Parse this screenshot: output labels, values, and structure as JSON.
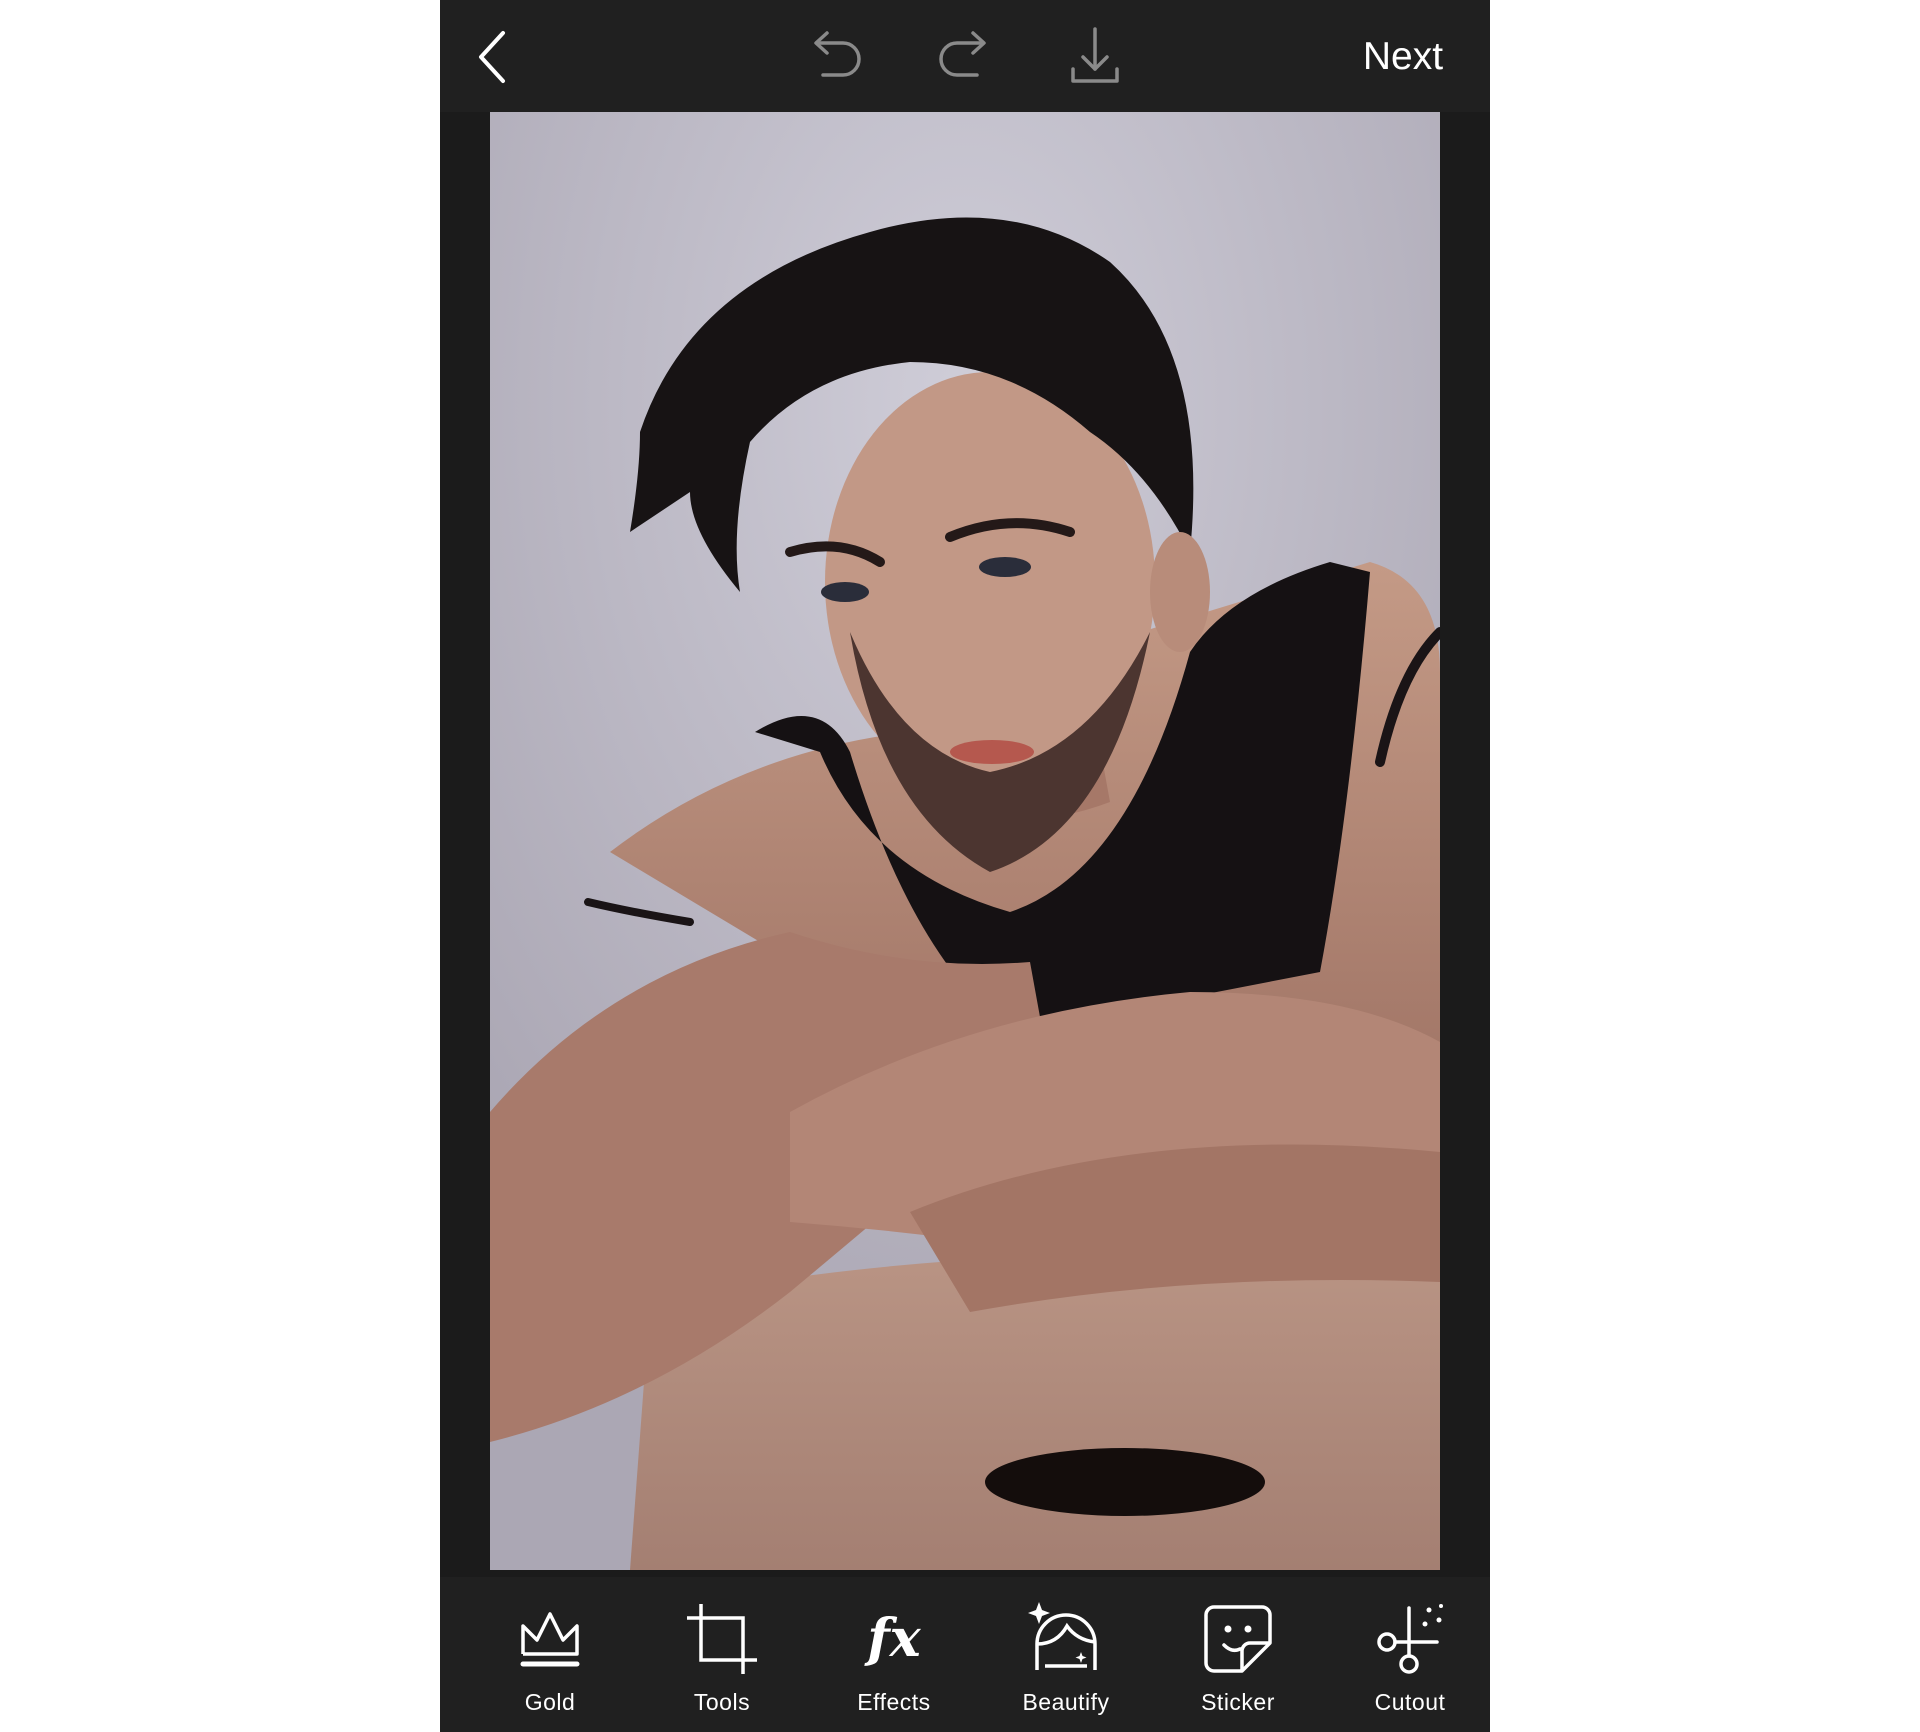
{
  "topbar": {
    "back_icon": "chevron-left-icon",
    "undo_icon": "undo-icon",
    "redo_icon": "redo-icon",
    "download_icon": "download-icon",
    "next_label": "Next"
  },
  "photo": {
    "subject": "portrait-photo"
  },
  "toolbar": {
    "items": [
      {
        "label": "Gold",
        "icon": "crown-icon"
      },
      {
        "label": "Tools",
        "icon": "crop-icon"
      },
      {
        "label": "Effects",
        "icon": "fx-icon",
        "glyph": "fx"
      },
      {
        "label": "Beautify",
        "icon": "face-sparkle-icon"
      },
      {
        "label": "Sticker",
        "icon": "sticker-icon"
      },
      {
        "label": "Cutout",
        "icon": "scissors-icon"
      }
    ]
  },
  "colors": {
    "bar": "#202020",
    "canvas": "#1b1b1b",
    "text": "#ffffff"
  }
}
